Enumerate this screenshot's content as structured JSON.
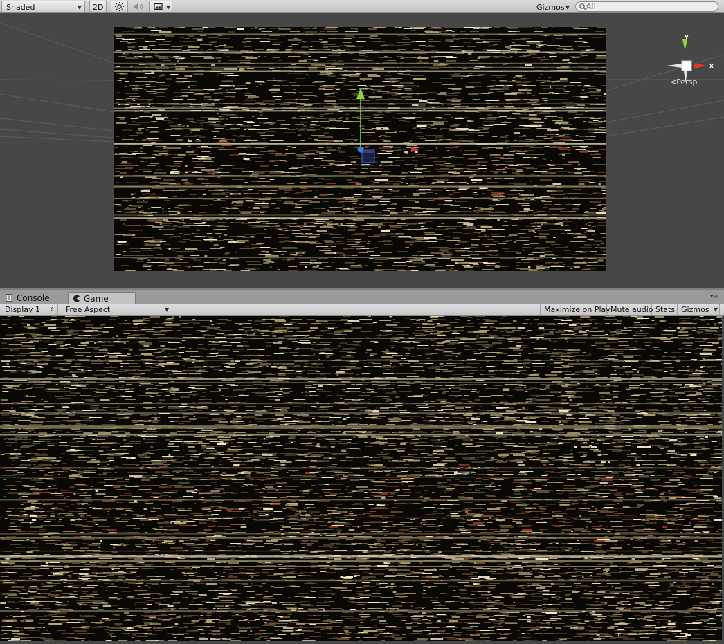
{
  "scene_toolbar": {
    "shading_mode": "Shaded",
    "mode_2d": "2D",
    "lighting_icon": "sun-icon",
    "audio_icon": "speaker-icon",
    "effects_icon": "image-icon",
    "gizmos_label": "Gizmos",
    "search_placeholder": "All"
  },
  "scene_gizmo": {
    "axis_y": "y",
    "axis_x": "x",
    "projection_label": "Persp"
  },
  "tabs": [
    {
      "label": "Console",
      "icon": "console-icon",
      "active": false
    },
    {
      "label": "Game",
      "icon": "pacman-icon",
      "active": true
    }
  ],
  "game_toolbar": {
    "display": "Display 1",
    "aspect": "Free Aspect",
    "maximize_on_play": "Maximize on Play",
    "mute_audio": "Mute audio",
    "stats": "Stats",
    "gizmos": "Gizmos"
  },
  "colors": {
    "axis_y": "#8fd63a",
    "axis_x": "#e8331f",
    "pivot": "#3d7de0",
    "editor_bg": "#474747"
  }
}
